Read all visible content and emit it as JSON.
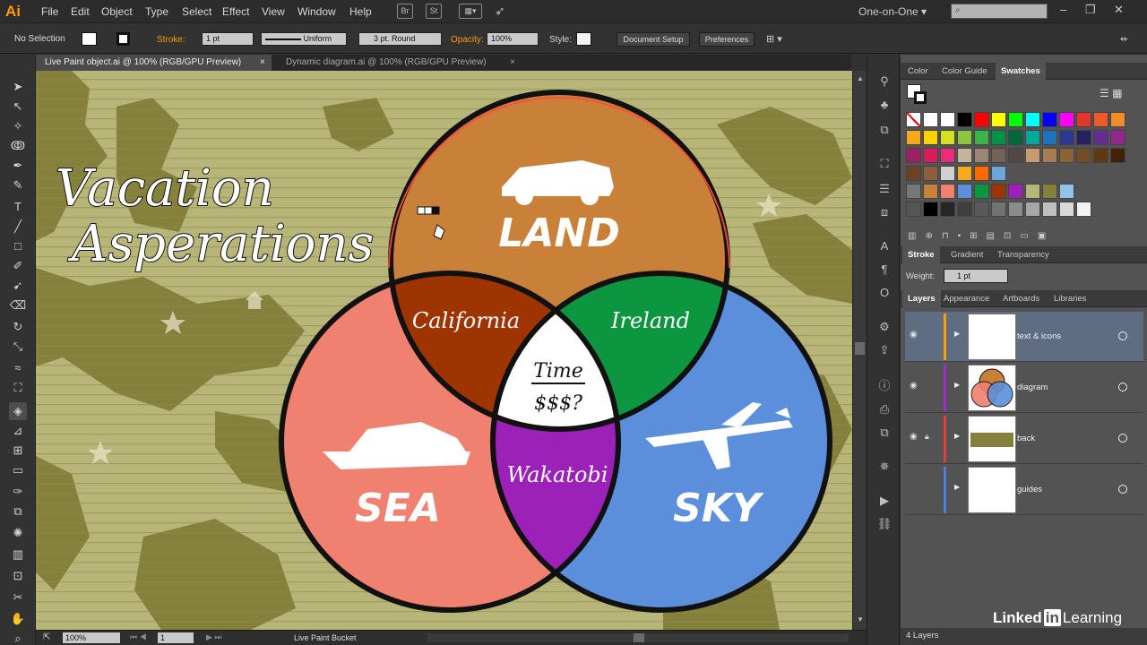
{
  "app": {
    "logo": "Ai",
    "workspace": "One-on-One",
    "menu": [
      "File",
      "Edit",
      "Object",
      "Type",
      "Select",
      "Effect",
      "View",
      "Window",
      "Help"
    ],
    "bridge_label": "Br",
    "stock_label": "St"
  },
  "control": {
    "selection": "No Selection",
    "stroke_label": "Stroke:",
    "stroke_weight": "1 pt",
    "profile": "Uniform",
    "brush": "3 pt. Round",
    "opacity_label": "Opacity:",
    "opacity": "100%",
    "style_label": "Style:",
    "doc_setup": "Document Setup",
    "preferences": "Preferences"
  },
  "tabs": [
    {
      "label": "Live Paint object.ai @ 100% (RGB/GPU Preview)",
      "close": "×"
    },
    {
      "label": "Dynamic diagram.ai @ 100% (RGB/GPU Preview)",
      "close": "×"
    }
  ],
  "artwork": {
    "title_line1": "Vacation",
    "title_line2": "Asperations",
    "land": "LAND",
    "sea": "SEA",
    "sky": "SKY",
    "california": "California",
    "ireland": "Ireland",
    "wakatobi": "Wakatobi",
    "time": "Time",
    "money": "$$$?"
  },
  "status": {
    "zoom": "100%",
    "page": "1",
    "tool": "Live Paint Bucket"
  },
  "panels": {
    "color_tabs": [
      "Color",
      "Color Guide",
      "Swatches"
    ],
    "stroke_tabs": [
      "Stroke",
      "Gradient",
      "Transparency"
    ],
    "weight_label": "Weight:",
    "weight": "1 pt",
    "layer_tabs": [
      "Layers",
      "Appearance",
      "Artboards",
      "Libraries"
    ],
    "layers": [
      {
        "name": "text & icons",
        "color": "#ff9a00"
      },
      {
        "name": "diagram",
        "color": "#9b2fc9"
      },
      {
        "name": "back",
        "color": "#e04040"
      },
      {
        "name": "guides",
        "color": "#4f7fd8"
      }
    ],
    "layer_count": "4 Layers"
  },
  "watermark": {
    "text1": "Linked",
    "text2": "in",
    "text3": "Learning"
  },
  "colors": {
    "land": "#c9813a",
    "sea": "#f08070",
    "sky": "#5b8fdb",
    "california": "#9e3400",
    "ireland": "#0d9640",
    "wakatobi": "#9b21b8",
    "map_bg": "#b7b577",
    "map_land": "#85813d"
  }
}
